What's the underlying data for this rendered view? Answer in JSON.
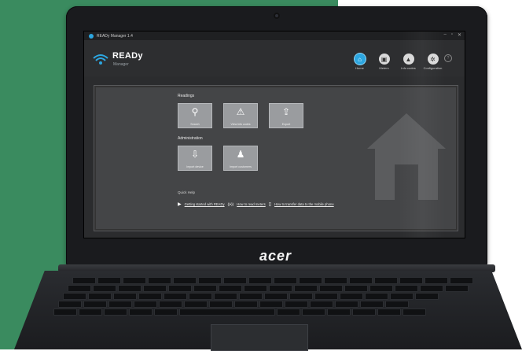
{
  "window": {
    "title": "READy Manager 1.4",
    "controls": [
      "–",
      "▫",
      "✕"
    ]
  },
  "app": {
    "logo_title": "READy",
    "logo_subtitle": "Manager",
    "accent": "#2ca6e0"
  },
  "nav": [
    {
      "label": "Home",
      "icon": "home-icon",
      "glyph": "⌂",
      "active": true
    },
    {
      "label": "Meters",
      "icon": "meter-icon",
      "glyph": "▣",
      "active": false
    },
    {
      "label": "Info codes",
      "icon": "warning-icon",
      "glyph": "▲",
      "active": false
    },
    {
      "label": "Configuration",
      "icon": "gear-icon",
      "glyph": "✲",
      "active": false
    }
  ],
  "help": "?",
  "readings": {
    "heading": "Readings",
    "tiles": [
      {
        "label": "Search",
        "icon": "search-icon",
        "glyph": "⚲"
      },
      {
        "label": "View info codes",
        "icon": "warning-icon",
        "glyph": "⚠"
      },
      {
        "label": "Export",
        "icon": "export-icon",
        "glyph": "⇪"
      }
    ]
  },
  "administration": {
    "heading": "Administration",
    "tiles": [
      {
        "label": "Import device",
        "icon": "import-device-icon",
        "glyph": "⇩"
      },
      {
        "label": "Import customers",
        "icon": "import-customers-icon",
        "glyph": "♟"
      }
    ]
  },
  "quick_help": {
    "heading": "Quick Help",
    "links": [
      {
        "label": "Getting started with READy",
        "icon": "play-icon",
        "glyph": "▶"
      },
      {
        "label": "How to read meters",
        "icon": "radio-icon",
        "glyph": "((•))"
      },
      {
        "label": "How to transfer data to the mobile phone",
        "icon": "phone-icon",
        "glyph": "▯"
      }
    ]
  },
  "laptop": {
    "brand": "acer"
  }
}
